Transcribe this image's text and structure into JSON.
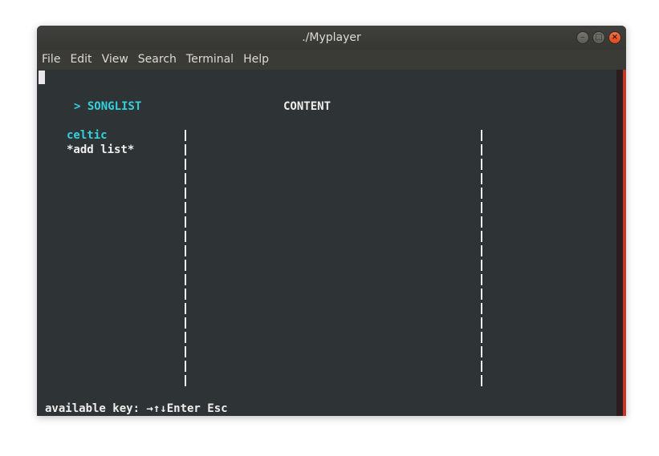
{
  "window": {
    "title": "./Myplayer",
    "controls": [
      "minimize-icon",
      "maximize-icon",
      "close-icon"
    ]
  },
  "menu": {
    "items": [
      "File",
      "Edit",
      "View",
      "Search",
      "Terminal",
      "Help"
    ]
  },
  "terminal": {
    "songlist_header": "> SONGLIST",
    "content_header": "CONTENT",
    "songlists": [
      {
        "label": "celtic",
        "selected": true
      },
      {
        "label": "*add list*",
        "selected": false
      }
    ],
    "footer_keys": "available key: →↑↓Enter Esc"
  },
  "colors": {
    "terminal_bg": "#2e3436",
    "highlight": "#34d0dc",
    "text": "#eeeeec",
    "scrollbar_accent": "#c0392b"
  }
}
